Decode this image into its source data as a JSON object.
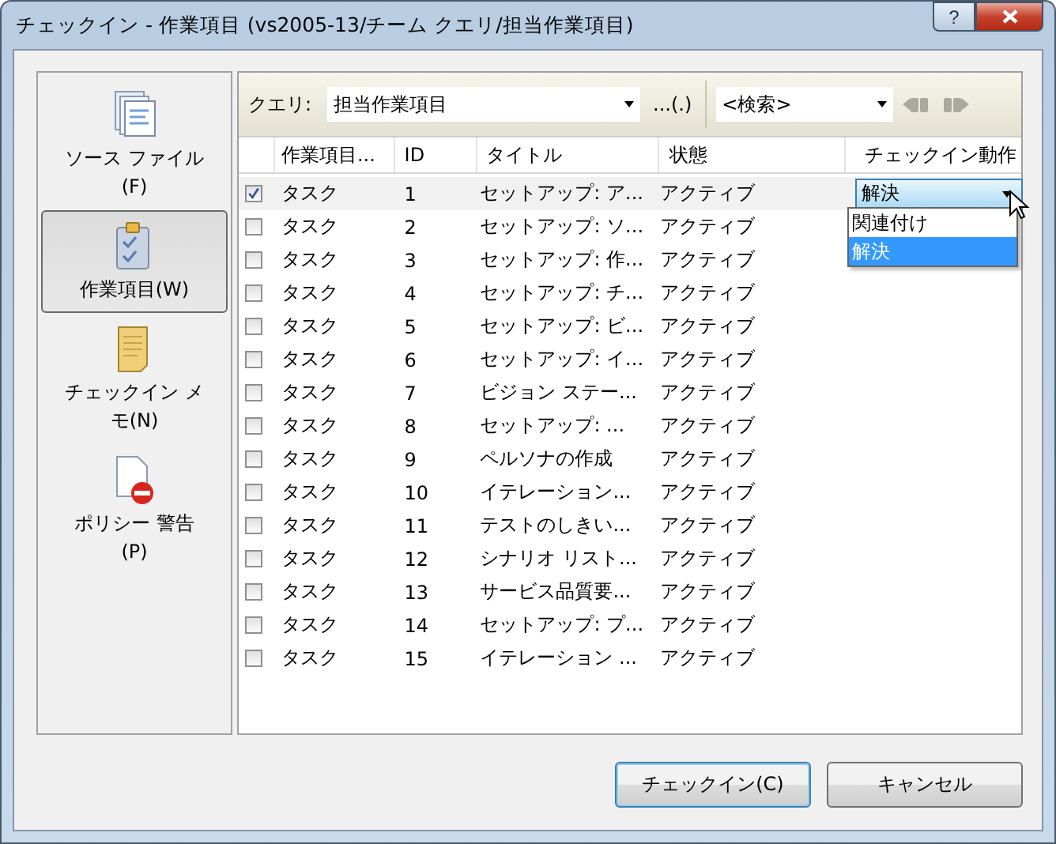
{
  "window": {
    "title": "チェックイン - 作業項目 (vs2005-13/チーム クエリ/担当作業項目)",
    "help_button": "?"
  },
  "sidebar": {
    "items": [
      {
        "label": "ソース ファイル(F)",
        "kind": "files",
        "selected": false
      },
      {
        "label": "作業項目(W)",
        "kind": "workitems",
        "selected": true
      },
      {
        "label": "チェックイン メモ(N)",
        "kind": "notes",
        "selected": false
      },
      {
        "label": "ポリシー 警告(P)",
        "kind": "policy",
        "selected": false
      }
    ]
  },
  "toolbar": {
    "query_label": "クエリ:",
    "query_value": "担当作業項目",
    "more_button": "...(.)",
    "search_value": "<検索>"
  },
  "table": {
    "columns": [
      "作業項目...",
      "ID",
      "タイトル",
      "状態",
      "チェックイン動作"
    ],
    "rows": [
      {
        "checked": true,
        "type": "タスク",
        "id": "1",
        "title": "セットアップ: ア...",
        "state": "アクティブ",
        "action": "解決"
      },
      {
        "checked": false,
        "type": "タスク",
        "id": "2",
        "title": "セットアップ: ソ...",
        "state": "アクティブ"
      },
      {
        "checked": false,
        "type": "タスク",
        "id": "3",
        "title": "セットアップ: 作...",
        "state": "アクティブ"
      },
      {
        "checked": false,
        "type": "タスク",
        "id": "4",
        "title": "セットアップ: チ...",
        "state": "アクティブ"
      },
      {
        "checked": false,
        "type": "タスク",
        "id": "5",
        "title": "セットアップ: ビ...",
        "state": "アクティブ"
      },
      {
        "checked": false,
        "type": "タスク",
        "id": "6",
        "title": "セットアップ: イ...",
        "state": "アクティブ"
      },
      {
        "checked": false,
        "type": "タスク",
        "id": "7",
        "title": "ビジョン ステー...",
        "state": "アクティブ"
      },
      {
        "checked": false,
        "type": "タスク",
        "id": "8",
        "title": "セットアップ: ...",
        "state": "アクティブ"
      },
      {
        "checked": false,
        "type": "タスク",
        "id": "9",
        "title": "ペルソナの作成",
        "state": "アクティブ"
      },
      {
        "checked": false,
        "type": "タスク",
        "id": "10",
        "title": "イテレーション...",
        "state": "アクティブ"
      },
      {
        "checked": false,
        "type": "タスク",
        "id": "11",
        "title": "テストのしきい...",
        "state": "アクティブ"
      },
      {
        "checked": false,
        "type": "タスク",
        "id": "12",
        "title": "シナリオ リスト...",
        "state": "アクティブ"
      },
      {
        "checked": false,
        "type": "タスク",
        "id": "13",
        "title": "サービス品質要...",
        "state": "アクティブ"
      },
      {
        "checked": false,
        "type": "タスク",
        "id": "14",
        "title": "セットアップ: プ...",
        "state": "アクティブ"
      },
      {
        "checked": false,
        "type": "タスク",
        "id": "15",
        "title": "イテレーション ...",
        "state": "アクティブ"
      }
    ]
  },
  "action_dropdown": {
    "options": [
      {
        "label": "関連付け",
        "selected": false
      },
      {
        "label": "解決",
        "selected": true
      }
    ]
  },
  "buttons": [
    "チェックイン(C)",
    "キャンセル"
  ]
}
